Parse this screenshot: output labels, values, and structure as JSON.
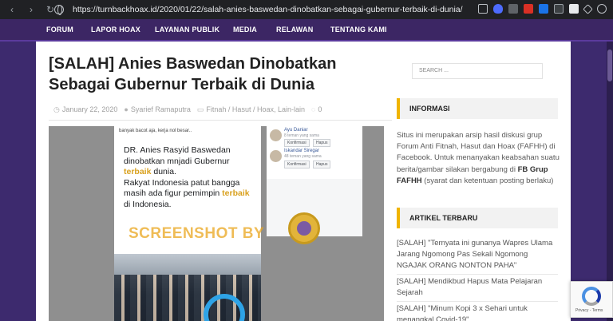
{
  "browser": {
    "url": "https://turnbackhoax.id/2020/01/22/salah-anies-baswedan-dinobatkan-sebagai-gubernur-terbaik-di-dunia/",
    "nav_back": "‹",
    "nav_forward": "›",
    "nav_reload": "↻"
  },
  "sitenav": {
    "items": [
      "FORUM",
      "LAPOR HOAX",
      "LAYANAN PUBLIK",
      "MEDIA",
      "RELAWAN",
      "TENTANG KAMI"
    ]
  },
  "article": {
    "title": "[SALAH] Anies Baswedan Dinobatkan Sebagai Gubernur Terbaik di Dunia",
    "date": "January 22, 2020",
    "author": "Syarief Ramaputra",
    "categories": "Fitnah / Hasut / Hoax, Lain-lain",
    "comments": "0"
  },
  "figure": {
    "post_snip": "banyak bacot aja, kerja nol besar..",
    "post_text_1": "DR. Anies Rasyid Baswedan dinobatkan mnjadi Gubernur ",
    "post_hl_1": "terbaik",
    "post_text_2": " dunia.",
    "post_text_3": "Rakyat Indonesia patut bangga masih ada figur pemimpin ",
    "post_hl_2": "terbaik",
    "post_text_4": " di Indonesia.",
    "watermark": "SCREENSHOT BY",
    "friend1_name": "Ayu Daniar",
    "friend1_sub": "8 teman yang sama",
    "friend2_name": "Iskandar Siregar",
    "friend2_sub": "48 teman yang sama",
    "btn_confirm": "Konfirmasi",
    "btn_delete": "Hapus"
  },
  "sidebar": {
    "search_placeholder": "SEARCH ...",
    "info_title": "INFORMASI",
    "info_text_1": "Situs ini merupakan arsip hasil diskusi grup Forum Anti Fitnah, Hasut dan Hoax (FAFHH) di Facebook. Untuk menanyakan keabsahan suatu berita/gambar silakan bergabung di ",
    "info_link": "FB Grup FAFHH",
    "info_text_2": " (syarat dan ketentuan posting berlaku)",
    "articles_title": "ARTIKEL TERBARU",
    "articles": [
      "[SALAH] \"Ternyata ini gunanya Wapres Ulama Jarang Ngomong Pas Sekali Ngomong NGAJAK ORANG NONTON PAHA\"",
      "[SALAH] Mendikbud Hapus Mata Pelajaran Sejarah",
      "[SALAH] \"Minum Kopi 3 x Sehari untuk menangkal Covid-19\""
    ]
  },
  "recaptcha": {
    "text": "Privacy - Terms"
  }
}
